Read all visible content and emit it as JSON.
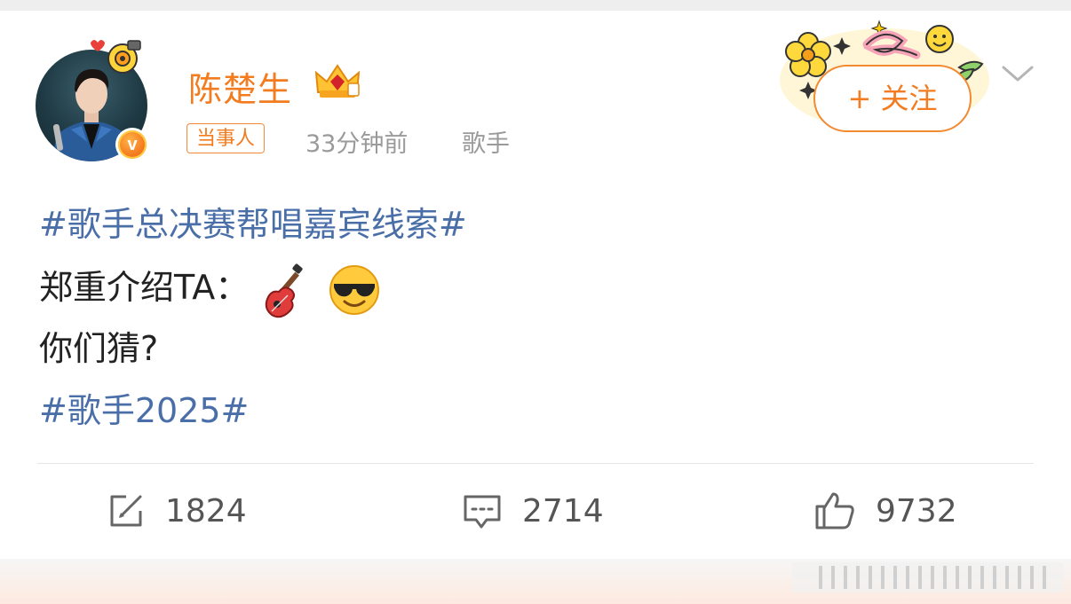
{
  "post": {
    "author": "陈楚生",
    "badge": "当事人",
    "time": "33分钟前",
    "source": "歌手",
    "follow_label": "+ 关注",
    "topic1": "#歌手总决赛帮唱嘉宾线索#",
    "line2": "郑重介绍TA：",
    "line3": "你们猜?",
    "topic2": "#歌手2025#",
    "emojis": [
      "guitar-emoji",
      "sunglasses-emoji"
    ]
  },
  "actions": {
    "repost_count": "1824",
    "comment_count": "2714",
    "like_count": "9732"
  },
  "colors": {
    "accent": "#f27c1f",
    "link": "#4a6fa8",
    "text": "#222222",
    "muted": "#9a9a9a"
  }
}
